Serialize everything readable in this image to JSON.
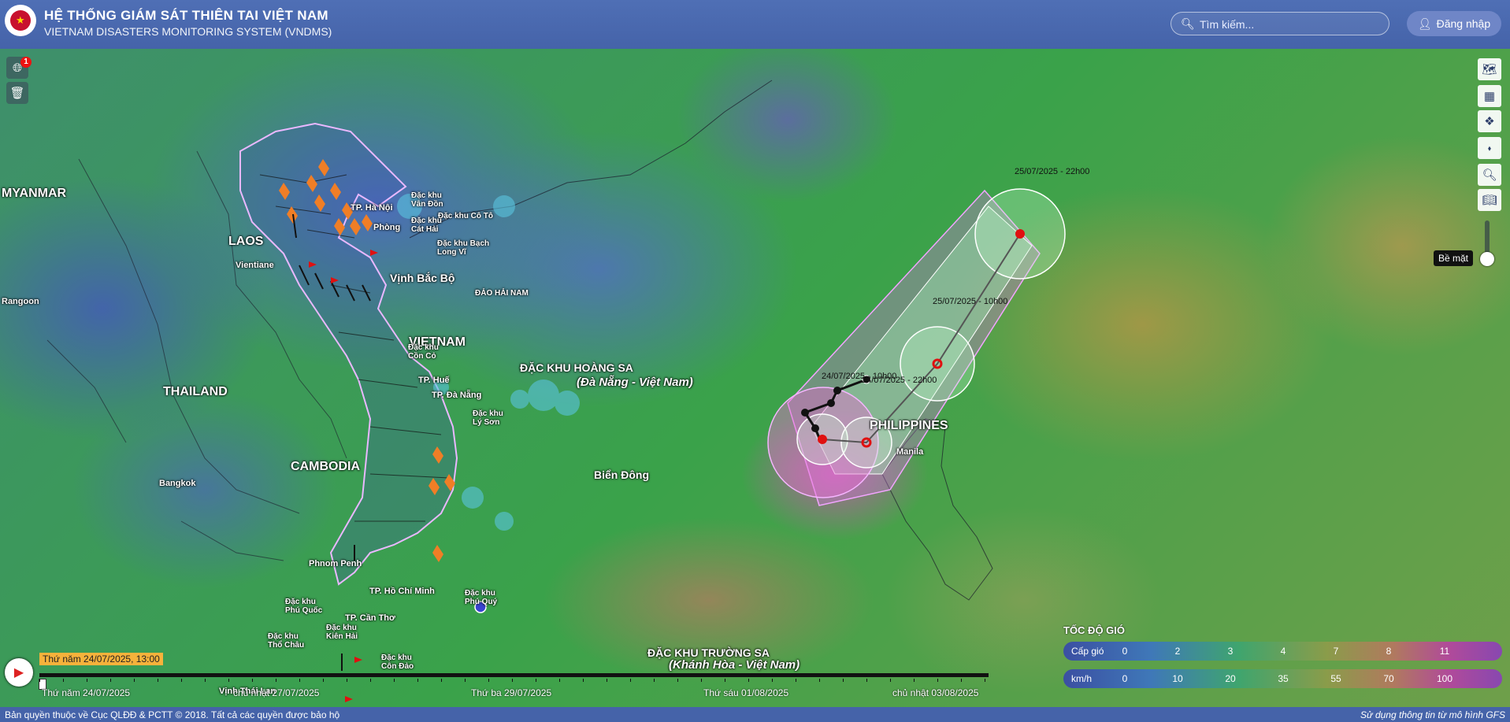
{
  "header": {
    "title": "HỆ THỐNG GIÁM SÁT THIÊN TAI VIỆT NAM",
    "subtitle": "VIETNAM DISASTERS MONITORING SYSTEM (VNDMS)",
    "search_placeholder": "Tìm kiếm...",
    "login_label": "Đăng nhập"
  },
  "left_tools": {
    "notification_count": "1"
  },
  "layer_control": {
    "label": "Bề mặt"
  },
  "places": {
    "myanmar": "MYANMAR",
    "laos": "LAOS",
    "thailand": "THAILAND",
    "cambodia": "CAMBODIA",
    "vietnam": "VIETNAM",
    "philippines": "PHILIPPINES",
    "vientiane": "Vientiane",
    "rangoon": "Rangoon",
    "bangkok": "Bangkok",
    "phnom_penh": "Phnom Penh",
    "manila": "Manila",
    "ha_noi": "TP. Hà Nội",
    "hai_phong": "Phòng",
    "van_don": "Đặc khu\nVân Đồn",
    "co_to": "Đặc khu Cô Tô",
    "cat_hai": "Đặc khu\nCát Hải",
    "bach_long_vi": "Đặc khu Bạch\nLong Vĩ",
    "vinh_bac_bo": "Vịnh Bắc Bộ",
    "dao_hai_nam": "ĐẢO HẢI NAM",
    "con_co": "Đặc khu\nCồn Cỏ",
    "hue": "TP. Huế",
    "da_nang": "TP. Đà Nẵng",
    "ly_son": "Đặc khu\nLý Sơn",
    "hoang_sa": "ĐẶC KHU HOÀNG SA",
    "hoang_sa_sub": "(Đà Nẵng - Việt Nam)",
    "bien_dong": "Biển Đông",
    "ho_chi_minh": "TP. Hồ Chí Minh",
    "can_tho": "TP. Cần Thơ",
    "phu_quoc": "Đặc khu\nPhú Quốc",
    "tho_chau": "Đặc khu\nThổ Châu",
    "kien_hai": "Đặc khu\nKiên Hải",
    "con_dao": "Đặc khu\nCôn Đảo",
    "phu_quy": "Đặc khu\nPhú Quý",
    "truong_sa": "ĐẶC KHU TRƯỜNG SA",
    "truong_sa_sub": "(Khánh Hòa - Việt Nam)",
    "vinh_thai_lan": "Vịnh Thái Lan"
  },
  "storm_track": [
    {
      "label": "24/07/2025 - 10h00"
    },
    {
      "label": "24/07/2025 - 22h00"
    },
    {
      "label": "25/07/2025 - 10h00"
    },
    {
      "label": "25/07/2025 - 22h00"
    }
  ],
  "timeline": {
    "current": "Thứ năm 24/07/2025, 13:00",
    "days": [
      "Thứ năm 24/07/2025",
      "chủ nhật 27/07/2025",
      "Thứ ba 29/07/2025",
      "Thứ sáu 01/08/2025",
      "chủ nhật 03/08/2025"
    ],
    "progress": 0
  },
  "legend": {
    "title": "TỐC ĐỘ GIÓ",
    "beaufort_label": "Cấp gió",
    "beaufort_values": [
      "0",
      "2",
      "3",
      "4",
      "7",
      "8",
      "11"
    ],
    "kmh_label": "km/h",
    "kmh_values": [
      "0",
      "10",
      "20",
      "35",
      "55",
      "70",
      "100"
    ]
  },
  "footer": {
    "copyright": "Bản quyền thuộc về Cục QLĐĐ & PCTT © 2018. Tất cả các quyền được bảo hộ",
    "source": "Sử dụng thông tin từ mô hình GFS"
  }
}
